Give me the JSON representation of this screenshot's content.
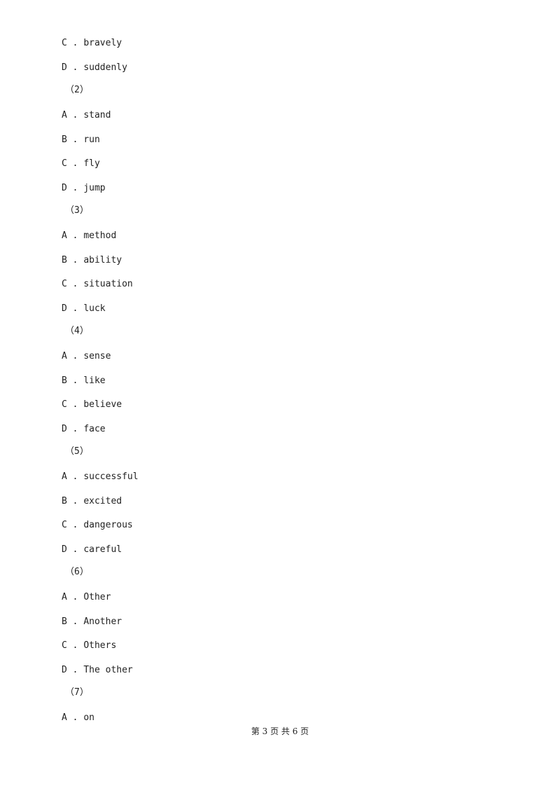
{
  "items": [
    {
      "type": "option",
      "letter": "C",
      "text": "bravely"
    },
    {
      "type": "option",
      "letter": "D",
      "text": "suddenly"
    },
    {
      "type": "number",
      "text": "（2）"
    },
    {
      "type": "option",
      "letter": "A",
      "text": "stand"
    },
    {
      "type": "option",
      "letter": "B",
      "text": "run"
    },
    {
      "type": "option",
      "letter": "C",
      "text": "fly"
    },
    {
      "type": "option",
      "letter": "D",
      "text": "jump"
    },
    {
      "type": "number",
      "text": "（3）"
    },
    {
      "type": "option",
      "letter": "A",
      "text": "method"
    },
    {
      "type": "option",
      "letter": "B",
      "text": "ability"
    },
    {
      "type": "option",
      "letter": "C",
      "text": "situation"
    },
    {
      "type": "option",
      "letter": "D",
      "text": "luck"
    },
    {
      "type": "number",
      "text": "（4）"
    },
    {
      "type": "option",
      "letter": "A",
      "text": "sense"
    },
    {
      "type": "option",
      "letter": "B",
      "text": "like"
    },
    {
      "type": "option",
      "letter": "C",
      "text": "believe"
    },
    {
      "type": "option",
      "letter": "D",
      "text": "face"
    },
    {
      "type": "number",
      "text": "（5）"
    },
    {
      "type": "option",
      "letter": "A",
      "text": "successful"
    },
    {
      "type": "option",
      "letter": "B",
      "text": "excited"
    },
    {
      "type": "option",
      "letter": "C",
      "text": "dangerous"
    },
    {
      "type": "option",
      "letter": "D",
      "text": "careful"
    },
    {
      "type": "number",
      "text": "（6）"
    },
    {
      "type": "option",
      "letter": "A",
      "text": "Other"
    },
    {
      "type": "option",
      "letter": "B",
      "text": "Another"
    },
    {
      "type": "option",
      "letter": "C",
      "text": "Others"
    },
    {
      "type": "option",
      "letter": "D",
      "text": "The other"
    },
    {
      "type": "number",
      "text": "（7）"
    },
    {
      "type": "option",
      "letter": "A",
      "text": "on"
    }
  ],
  "footer": {
    "text": "第 3 页 共 6 页"
  }
}
